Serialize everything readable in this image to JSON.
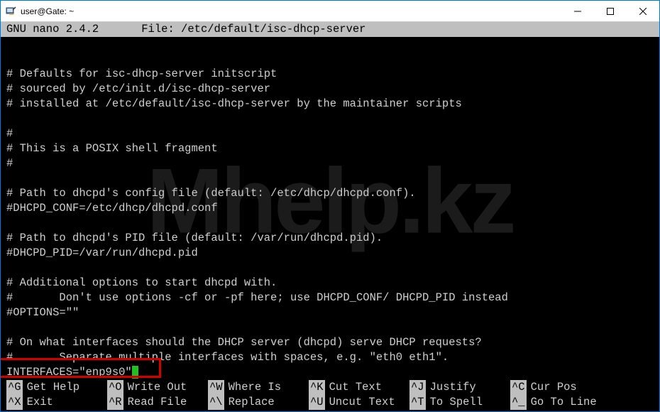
{
  "window": {
    "title": "user@Gate: ~"
  },
  "nano": {
    "version": "GNU nano 2.4.2",
    "file_label": "File: /etc/default/isc-dhcp-server"
  },
  "lines": [
    "",
    "# Defaults for isc-dhcp-server initscript",
    "# sourced by /etc/init.d/isc-dhcp-server",
    "# installed at /etc/default/isc-dhcp-server by the maintainer scripts",
    "",
    "#",
    "# This is a POSIX shell fragment",
    "#",
    "",
    "# Path to dhcpd's config file (default: /etc/dhcp/dhcpd.conf).",
    "#DHCPD_CONF=/etc/dhcp/dhcpd.conf",
    "",
    "# Path to dhcpd's PID file (default: /var/run/dhcpd.pid).",
    "#DHCPD_PID=/var/run/dhcpd.pid",
    "",
    "# Additional options to start dhcpd with.",
    "#       Don't use options -cf or -pf here; use DHCPD_CONF/ DHCPD_PID instead",
    "#OPTIONS=\"\"",
    "",
    "# On what interfaces should the DHCP server (dhcpd) serve DHCP requests?",
    "#       Separate multiple interfaces with spaces, e.g. \"eth0 eth1\"."
  ],
  "interfaces_line": "INTERFACES=\"enp9s0\"",
  "watermark": "Mhelp.kz",
  "shortcuts": {
    "row1": [
      {
        "key": "^G",
        "label": "Get Help"
      },
      {
        "key": "^O",
        "label": "Write Out"
      },
      {
        "key": "^W",
        "label": "Where Is"
      },
      {
        "key": "^K",
        "label": "Cut Text"
      },
      {
        "key": "^J",
        "label": "Justify"
      },
      {
        "key": "^C",
        "label": "Cur Pos"
      }
    ],
    "row2": [
      {
        "key": "^X",
        "label": "Exit"
      },
      {
        "key": "^R",
        "label": "Read File"
      },
      {
        "key": "^\\",
        "label": "Replace"
      },
      {
        "key": "^U",
        "label": "Uncut Text"
      },
      {
        "key": "^T",
        "label": "To Spell"
      },
      {
        "key": "^_",
        "label": "Go To Line"
      }
    ]
  }
}
